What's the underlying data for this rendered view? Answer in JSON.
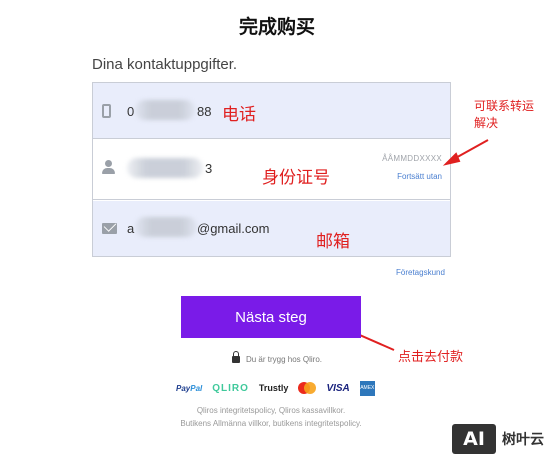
{
  "page_title": "完成购买",
  "subtitle": "Dina kontaktuppgifter.",
  "form": {
    "phone": {
      "prefix": "0",
      "suffix": "88",
      "icon": "phone-icon"
    },
    "personal_number": {
      "suffix": "3",
      "placeholder_hint": "ÅÅMMDDXXXX",
      "continue_link": "Fortsätt utan",
      "icon": "person-icon"
    },
    "email": {
      "prefix": "a",
      "suffix": "@gmail.com",
      "icon": "mail-icon"
    }
  },
  "annotations": {
    "phone": "电话",
    "personal_number": "身份证号",
    "email": "邮箱",
    "contact_support": [
      "可联系转运",
      "解决"
    ],
    "click_pay": "点击去付款"
  },
  "company_link": "Företagskund",
  "next_button": "Nästa steg",
  "secure_text": "Du är trygg hos Qliro.",
  "payments": {
    "paypal": {
      "part1": "Pay",
      "part2": "Pal"
    },
    "qliro": "QLIRO",
    "trustly": "Trustly",
    "visa": "VISA",
    "amex": "AMEX"
  },
  "legal": {
    "line1": "Qliros integritetspolicy, Qliros kassavillkor.",
    "line2": "Butikens Allmänna villkor, butikens integritetspolicy."
  },
  "watermark": {
    "logo": "AI",
    "name": "树叶云"
  },
  "colors": {
    "accent": "#7a1be8",
    "annotation": "#e02020",
    "link": "#4a7fd0",
    "field_bg": "#e9edfb"
  }
}
